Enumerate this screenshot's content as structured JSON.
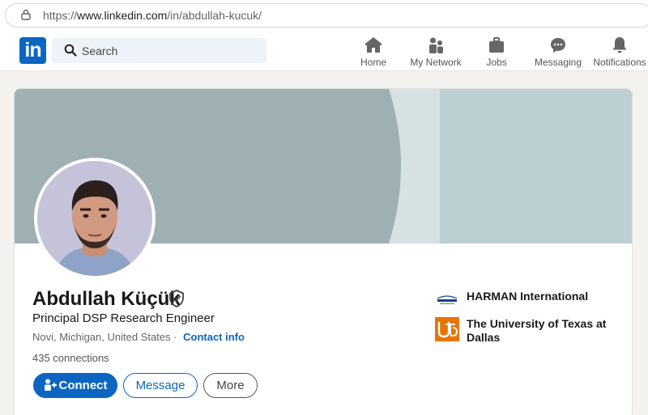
{
  "browser": {
    "url_prefix": "https://",
    "url_host": "www.linkedin.com",
    "url_path": "/in/abdullah-kucuk/"
  },
  "nav": {
    "logo": "in",
    "search_placeholder": "Search",
    "items": [
      {
        "label": "Home",
        "icon": "home-icon"
      },
      {
        "label": "My Network",
        "icon": "network-icon"
      },
      {
        "label": "Jobs",
        "icon": "briefcase-icon"
      },
      {
        "label": "Messaging",
        "icon": "messaging-icon"
      },
      {
        "label": "Notifications",
        "icon": "bell-icon"
      }
    ]
  },
  "profile": {
    "name": "Abdullah Küçük",
    "headline": "Principal DSP Research Engineer",
    "location": "Novi, Michigan, United States",
    "separator": "·",
    "contact_info": "Contact info",
    "connections": "435 connections"
  },
  "actions": {
    "connect": "Connect",
    "message": "Message",
    "more": "More"
  },
  "organizations": [
    {
      "name": "HARMAN International",
      "logo_text": "HARMAN"
    },
    {
      "name": "The University of Texas at Dallas",
      "logo_text": "UTD"
    }
  ],
  "colors": {
    "brand": "#0a66c2",
    "banner": "#a0b1b4",
    "utd_orange": "#e87500"
  }
}
